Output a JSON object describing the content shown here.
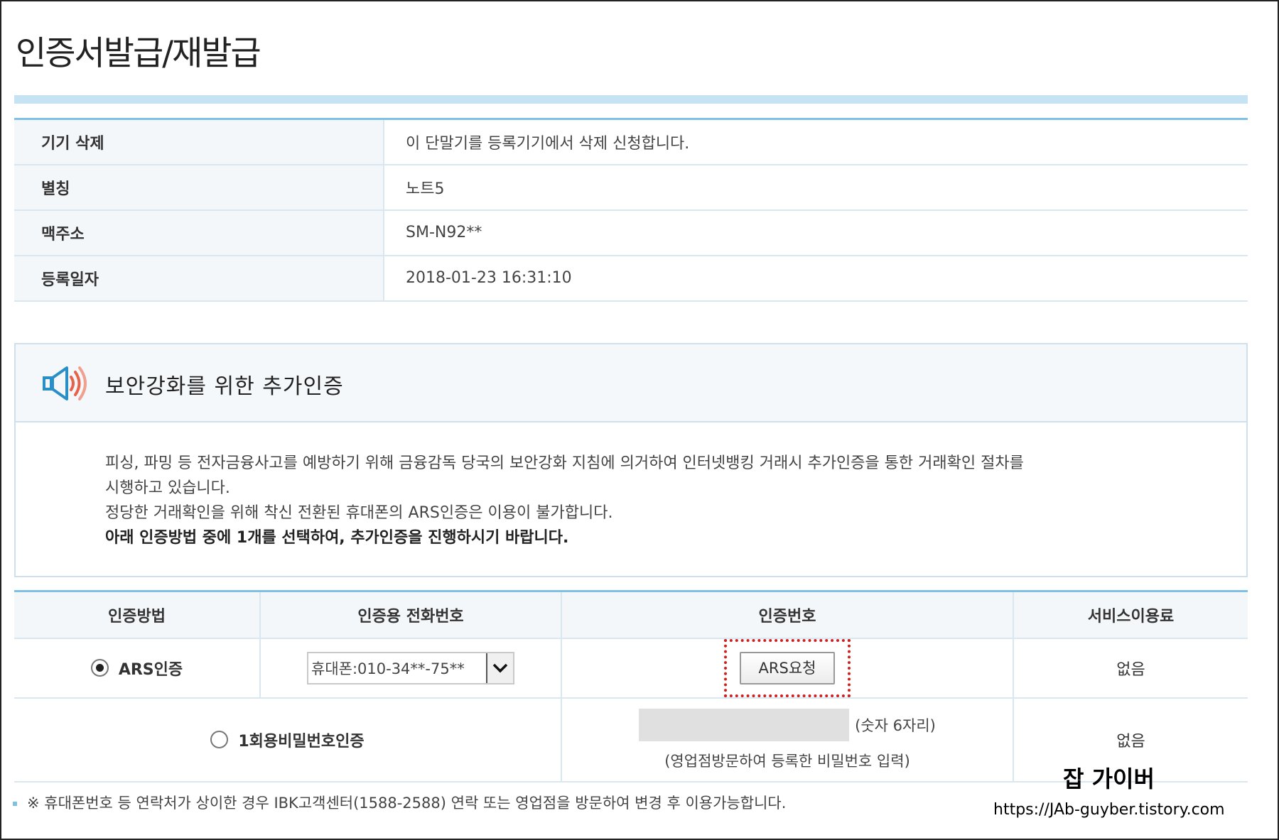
{
  "page_title": "인증서발급/재발급",
  "device_info": {
    "rows": [
      {
        "label": "기기 삭제",
        "value": "이 단말기를 등록기기에서 삭제 신청합니다."
      },
      {
        "label": "별칭",
        "value": "노트5"
      },
      {
        "label": "맥주소",
        "value": "SM-N92**"
      },
      {
        "label": "등록일자",
        "value": "2018-01-23 16:31:10"
      }
    ]
  },
  "notice": {
    "title": "보안강화를 위한 추가인증",
    "lines": [
      "피싱, 파밍 등 전자금융사고를 예방하기 위해 금융감독 당국의 보안강화 지침에 의거하여 인터넷뱅킹 거래시 추가인증을 통한 거래확인 절차를",
      "시행하고 있습니다.",
      "정당한 거래확인을 위해 착신 전환된 휴대폰의 ARS인증은 이용이 불가합니다."
    ],
    "emphasis": "아래 인증방법 중에 1개를 선택하여, 추가인증을 진행하시기 바랍니다."
  },
  "auth_table": {
    "headers": [
      "인증방법",
      "인증용 전화번호",
      "인증번호",
      "서비스이용료"
    ],
    "ars": {
      "method": "ARS인증",
      "selected": true,
      "phone_select": "휴대폰:010-34**-75**",
      "request_button": "ARS요청",
      "fee": "없음"
    },
    "otp": {
      "method": "1회용비밀번호인증",
      "selected": false,
      "input_hint": "(숫자 6자리)",
      "sub_hint": "(영업점방문하여 등록한 비밀번호 입력)",
      "fee": "없음"
    }
  },
  "footnote": "※ 휴대폰번호 등 연락처가 상이한 경우 IBK고객센터(1588-2588) 연락 또는 영업점을 방문하여 변경 후 이용가능합니다.",
  "watermark": {
    "name": "잡 가이버",
    "url": "https://JAb-guyber.tistory.com"
  },
  "colors": {
    "accent": "#7fc1e4",
    "title_bar": "#c5e3f3",
    "highlight_border": "#d11e1e",
    "header_bg": "#f4f7fa"
  },
  "icons": {
    "notice": "speaker-alert-icon",
    "select_arrow": "chevron-down-icon"
  }
}
